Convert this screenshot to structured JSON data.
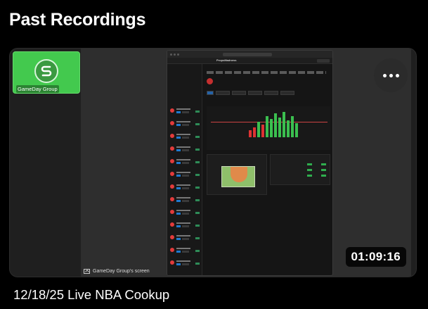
{
  "page": {
    "title": "Past Recordings"
  },
  "recording": {
    "title": "12/18/25 Live NBA Cookup",
    "duration": "01:09:16",
    "participant_name": "GameDay Group",
    "screen_owner_label": "GameDay Group's screen",
    "tile_color": "#43c94e",
    "more_icon": "more-horizontal-icon"
  },
  "shared_screen": {
    "app_brand": "PropsMadness"
  }
}
